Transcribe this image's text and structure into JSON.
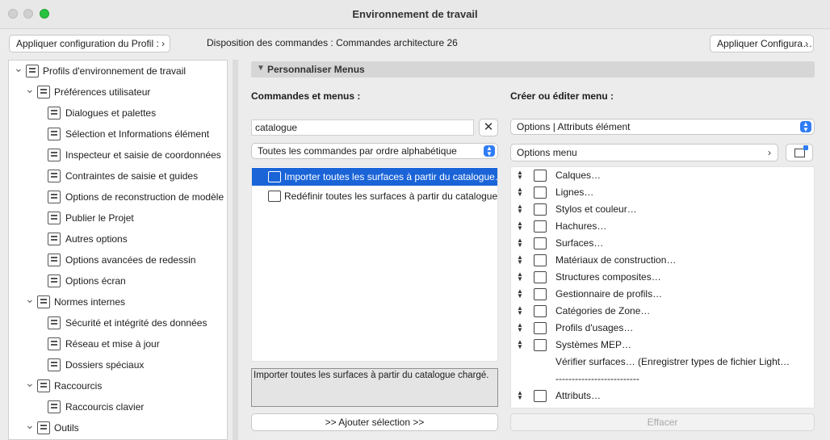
{
  "window": {
    "title": "Environnement de travail"
  },
  "toolbar": {
    "apply_profile_label": "Appliquer configuration du Profil :",
    "disposition_label": "Disposition des commandes :",
    "disposition_value": "Commandes architecture 26",
    "apply_config_label": "Appliquer Configura…"
  },
  "sidebar": {
    "items": [
      {
        "label": "Profils d'environnement de travail",
        "level": 0,
        "expanded": true,
        "icon": "profile-icon"
      },
      {
        "label": "Préférences utilisateur",
        "level": 1,
        "expanded": true,
        "icon": "preferences-icon"
      },
      {
        "label": "Dialogues et palettes",
        "level": 2,
        "icon": "dialogs-icon"
      },
      {
        "label": "Sélection et Informations élément",
        "level": 2,
        "icon": "selection-icon"
      },
      {
        "label": "Inspecteur et saisie de coordonnées",
        "level": 2,
        "icon": "xyz-icon"
      },
      {
        "label": "Contraintes de saisie et guides",
        "level": 2,
        "icon": "constraints-icon"
      },
      {
        "label": "Options de reconstruction de modèle",
        "level": 2,
        "icon": "rebuild-icon"
      },
      {
        "label": "Publier le Projet",
        "level": 2,
        "icon": "publish-icon"
      },
      {
        "label": "Autres options",
        "level": 2,
        "icon": "sliders-icon"
      },
      {
        "label": "Options avancées de redessin",
        "level": 2,
        "icon": "redraw-icon"
      },
      {
        "label": "Options écran",
        "level": 2,
        "icon": "screen-icon"
      },
      {
        "label": "Normes internes",
        "level": 1,
        "expanded": true,
        "icon": "standards-icon"
      },
      {
        "label": "Sécurité et intégrité des données",
        "level": 2,
        "icon": "security-icon"
      },
      {
        "label": "Réseau et mise à jour",
        "level": 2,
        "icon": "globe-icon"
      },
      {
        "label": "Dossiers spéciaux",
        "level": 2,
        "icon": "folder-icon"
      },
      {
        "label": "Raccourcis",
        "level": 1,
        "expanded": true,
        "icon": "shortcuts-icon"
      },
      {
        "label": "Raccourcis clavier",
        "level": 2,
        "icon": "keyboard-shortcut-icon"
      },
      {
        "label": "Outils",
        "level": 1,
        "expanded": true,
        "icon": "tools-icon"
      }
    ]
  },
  "panel": {
    "section_title": "Personnaliser Menus",
    "commands_label": "Commandes et menus :",
    "create_label": "Créer ou éditer menu :",
    "search_value": "catalogue",
    "sort_select": "Toutes les commandes par ordre alphabétique",
    "commands": [
      {
        "label": "Importer toutes les surfaces à partir du catalogue…",
        "selected": true
      },
      {
        "label": "Redéfinir toutes les surfaces à partir du catalogue…",
        "selected": false
      }
    ],
    "description": "Importer toutes les surfaces à partir du catalogue chargé.",
    "add_button": ">> Ajouter sélection >>",
    "menu_select": "Options | Attributs élément",
    "submenu_select": "Options menu",
    "menu_items": [
      {
        "label": "Calques…",
        "icon": "layers-icon"
      },
      {
        "label": "Lignes…",
        "icon": "lines-icon"
      },
      {
        "label": "Stylos et couleur…",
        "icon": "pen-icon"
      },
      {
        "label": "Hachures…",
        "icon": "hatch-icon"
      },
      {
        "label": "Surfaces…",
        "icon": "surfaces-icon"
      },
      {
        "label": "Matériaux de construction…",
        "icon": "materials-icon"
      },
      {
        "label": "Structures composites…",
        "icon": "composites-icon"
      },
      {
        "label": "Gestionnaire de profils…",
        "icon": "profile-manager-icon"
      },
      {
        "label": "Catégories de Zone…",
        "icon": "zone-icon"
      },
      {
        "label": "Profils d'usages…",
        "icon": "usage-icon"
      },
      {
        "label": "Systèmes MEP…",
        "icon": "mep-icon"
      },
      {
        "label": "Vérifier surfaces… (Enregistrer types de fichier Light…",
        "icon": ""
      },
      {
        "label": "--------------------------",
        "icon": ""
      },
      {
        "label": "Attributs…",
        "icon": "attributes-icon"
      }
    ],
    "erase_button": "Effacer"
  }
}
